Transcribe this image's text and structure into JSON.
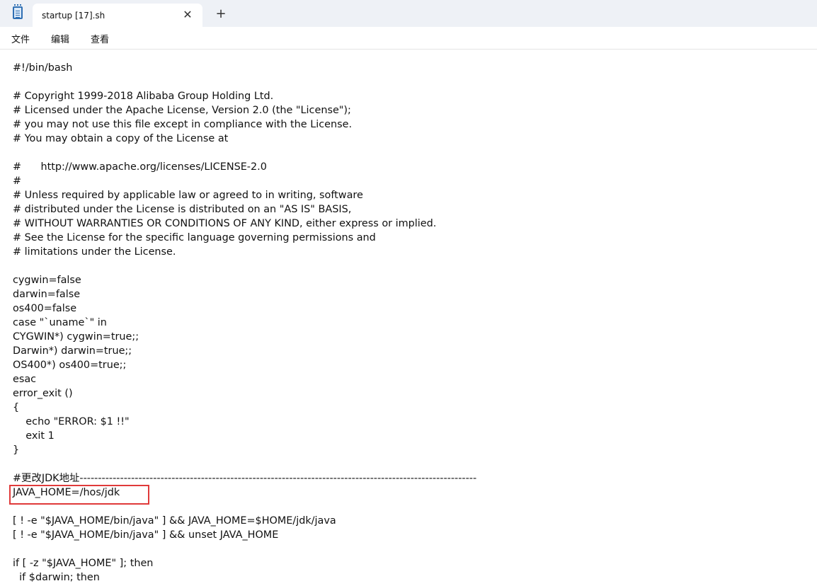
{
  "window": {
    "tab_title": "startup [17].sh",
    "close_symbol": "✕",
    "new_tab_symbol": "+"
  },
  "menu": {
    "items": [
      "文件",
      "编辑",
      "查看"
    ]
  },
  "editor": {
    "lines": [
      "#!/bin/bash",
      "",
      "# Copyright 1999-2018 Alibaba Group Holding Ltd.",
      "# Licensed under the Apache License, Version 2.0 (the \"License\");",
      "# you may not use this file except in compliance with the License.",
      "# You may obtain a copy of the License at",
      "",
      "#      http://www.apache.org/licenses/LICENSE-2.0",
      "#",
      "# Unless required by applicable law or agreed to in writing, software",
      "# distributed under the License is distributed on an \"AS IS\" BASIS,",
      "# WITHOUT WARRANTIES OR CONDITIONS OF ANY KIND, either express or implied.",
      "# See the License for the specific language governing permissions and",
      "# limitations under the License.",
      "",
      "cygwin=false",
      "darwin=false",
      "os400=false",
      "case \"`uname`\" in",
      "CYGWIN*) cygwin=true;;",
      "Darwin*) darwin=true;;",
      "OS400*) os400=true;;",
      "esac",
      "error_exit ()",
      "{",
      "    echo \"ERROR: $1 !!\"",
      "    exit 1",
      "}",
      "",
      "#更改JDK地址------------------------------------------------------------------------------------------------------------",
      "JAVA_HOME=/hos/jdk",
      "",
      "[ ! -e \"$JAVA_HOME/bin/java\" ] && JAVA_HOME=$HOME/jdk/java",
      "[ ! -e \"$JAVA_HOME/bin/java\" ] && unset JAVA_HOME",
      "",
      "if [ -z \"$JAVA_HOME\" ]; then",
      "  if $darwin; then"
    ]
  },
  "colors": {
    "highlight_border": "#e03a3a",
    "tabbar_bg": "#eef1f6"
  }
}
